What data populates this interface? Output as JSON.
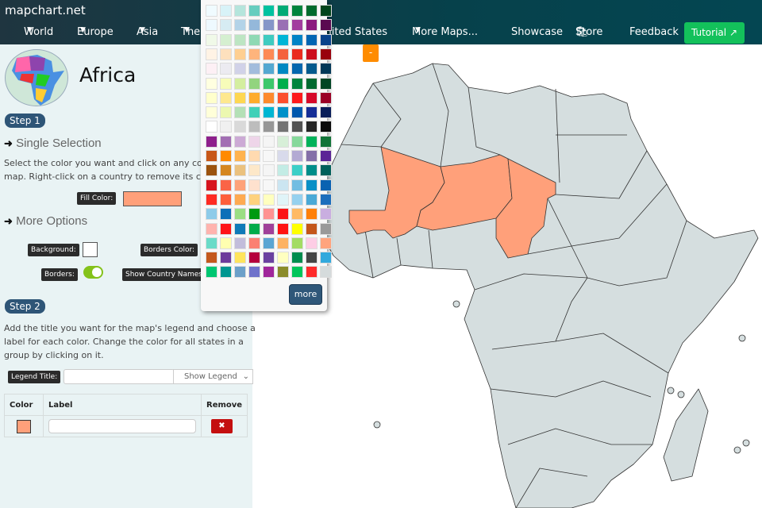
{
  "brand": "mapchart.net",
  "nav": {
    "items": [
      "World",
      "Europe",
      "Asia",
      "The Americas",
      "United States",
      "More Maps..."
    ],
    "showcase": "Showcase",
    "store": "Store",
    "feedback": "Feedback",
    "tutorial": "Tutorial"
  },
  "sidebar": {
    "title": "Africa",
    "step1": "Step 1",
    "single_selection": "Single Selection",
    "instructions": [
      "Select the color you want and click on any country on the",
      "map. Right-click on a country to remove its color or"
    ],
    "fill_color_label": "Fill Color:",
    "fill_color": "#ffa07a",
    "more_options": "More Options",
    "background_label": "Background:",
    "borders_color_label": "Borders Color:",
    "borders_label": "Borders:",
    "borders_on": true,
    "show_names_label": "Show Country Names:",
    "step2": "Step 2",
    "legend_text": [
      "Add the title you want for the map's legend and choose a",
      "label for each color. Change the color for all states in a",
      "group by clicking on it."
    ],
    "legend_title_label": "Legend Title:",
    "legend_title_value": "",
    "legend_select": "Show Legend",
    "table": {
      "headers": [
        "Color",
        "Label",
        "Remove"
      ],
      "rows": [
        {
          "color": "#ffa07a",
          "label": ""
        }
      ]
    }
  },
  "palette": {
    "more": "more",
    "rows": [
      [
        "#f0fbff",
        "#d8f3f8",
        "#b5e5dc",
        "#66cdbf",
        "#00c2a0",
        "#00ab75",
        "#00843d",
        "#006b2d",
        "#00441b"
      ],
      [
        "#eef9ff",
        "#d6ecf3",
        "#b3d3e8",
        "#94b8da",
        "#8596c8",
        "#9a70b4",
        "#a23d9e",
        "#8c1a7f",
        "#5a0a50"
      ],
      [
        "#f0f9e8",
        "#d5efd0",
        "#bde5c3",
        "#8fd9b4",
        "#3fcbc0",
        "#00b5d6",
        "#0083c6",
        "#0065b3",
        "#08418a"
      ],
      [
        "#fff3e5",
        "#fde0bd",
        "#fecf92",
        "#feb47c",
        "#fd8a56",
        "#f4623e",
        "#ea2b1f",
        "#cc0d1d",
        "#99000d"
      ],
      [
        "#fdf0f5",
        "#ecebf1",
        "#d1d2e8",
        "#a2bcdc",
        "#54a8d1",
        "#0088c2",
        "#0567ae",
        "#045a8d",
        "#023858"
      ],
      [
        "#ffffe0",
        "#f7fcb9",
        "#d4ee9f",
        "#92d47e",
        "#3dc76c",
        "#00ae4c",
        "#00843d",
        "#006930",
        "#004524"
      ],
      [
        "#ffffcc",
        "#fee88f",
        "#fed751",
        "#feac2c",
        "#fd8a2d",
        "#fb4f2e",
        "#fd1a1c",
        "#d6092a",
        "#9a0026"
      ],
      [
        "#ffffd9",
        "#ecf8b0",
        "#b4e0b6",
        "#41d0b8",
        "#00b6d3",
        "#0091c9",
        "#0058ad",
        "#152d96",
        "#081d58"
      ],
      [
        "#ffffff",
        "#f0f0f0",
        "#d9d9d9",
        "#bdbdbd",
        "#969696",
        "#737373",
        "#525252",
        "#252525",
        "#0a0a0a"
      ],
      [
        "#8e1f8c",
        "#a26eb3",
        "#ccaad5",
        "#eed5e9",
        "#f5f5f5",
        "#d7efd8",
        "#86d89b",
        "#00b25a",
        "#127438"
      ],
      [
        "#c85718",
        "#ff8a00",
        "#ffb34f",
        "#ffdab0",
        "#f7f7f7",
        "#d8daeb",
        "#b3aad3",
        "#8470a8",
        "#5b2496"
      ],
      [
        "#9c520e",
        "#d5861f",
        "#ebc17e",
        "#fde8c9",
        "#f5f5f5",
        "#c3ece5",
        "#3ccfc7",
        "#008d89",
        "#00605a"
      ],
      [
        "#d7141e",
        "#fa6447",
        "#fea27a",
        "#fee1ce",
        "#f7f7f7",
        "#cbe5f1",
        "#72bde2",
        "#0a90c6",
        "#0962b1"
      ],
      [
        "#ff2a22",
        "#fd5f3b",
        "#feaa51",
        "#fdd27e",
        "#ffffbf",
        "#e0f4f8",
        "#96d1ef",
        "#4aa9d6",
        "#1c6ebc"
      ],
      [
        "#8ecbe9",
        "#0d6fb8",
        "#9ade84",
        "#009a11",
        "#ff9392",
        "#fb1516",
        "#ffba64",
        "#ff8008",
        "#c9aee0"
      ],
      [
        "#ffb3ae",
        "#ff1418",
        "#0f7ab8",
        "#00ac4a",
        "#a04099",
        "#ff1212",
        "#ffff00",
        "#c4561a",
        "#999999"
      ],
      [
        "#6bdbc8",
        "#ffffb0",
        "#c2bddb",
        "#fb8072",
        "#5ba5d3",
        "#fdb263",
        "#a3dc63",
        "#fdcde5",
        "#ffa47e"
      ],
      [
        "#c4581d",
        "#6d3b9b",
        "#ffe45c",
        "#b5003d",
        "#6a41a0",
        "#ffffc0",
        "#008d4e",
        "#454545",
        "#32a9dd"
      ],
      [
        "#00c671",
        "#009690",
        "#6ca0c9",
        "#6f72cb",
        "#a0269a",
        "#8a8b2b",
        "#00c55a",
        "#ff2a2a",
        "#d5dbdc"
      ]
    ]
  },
  "map": {
    "zoom_out": "-",
    "land_color": "#d5dedf",
    "border_color": "#333333",
    "highlighted": {
      "countries": [
        "Mali",
        "Niger",
        "Chad"
      ],
      "color": "#ffa07a"
    }
  },
  "colors": {
    "nav": "#06414b",
    "tutorial": "#13c15b",
    "step": "#2e5577",
    "remove": "#c40f0f",
    "zoom_button": "#ff8c00"
  }
}
